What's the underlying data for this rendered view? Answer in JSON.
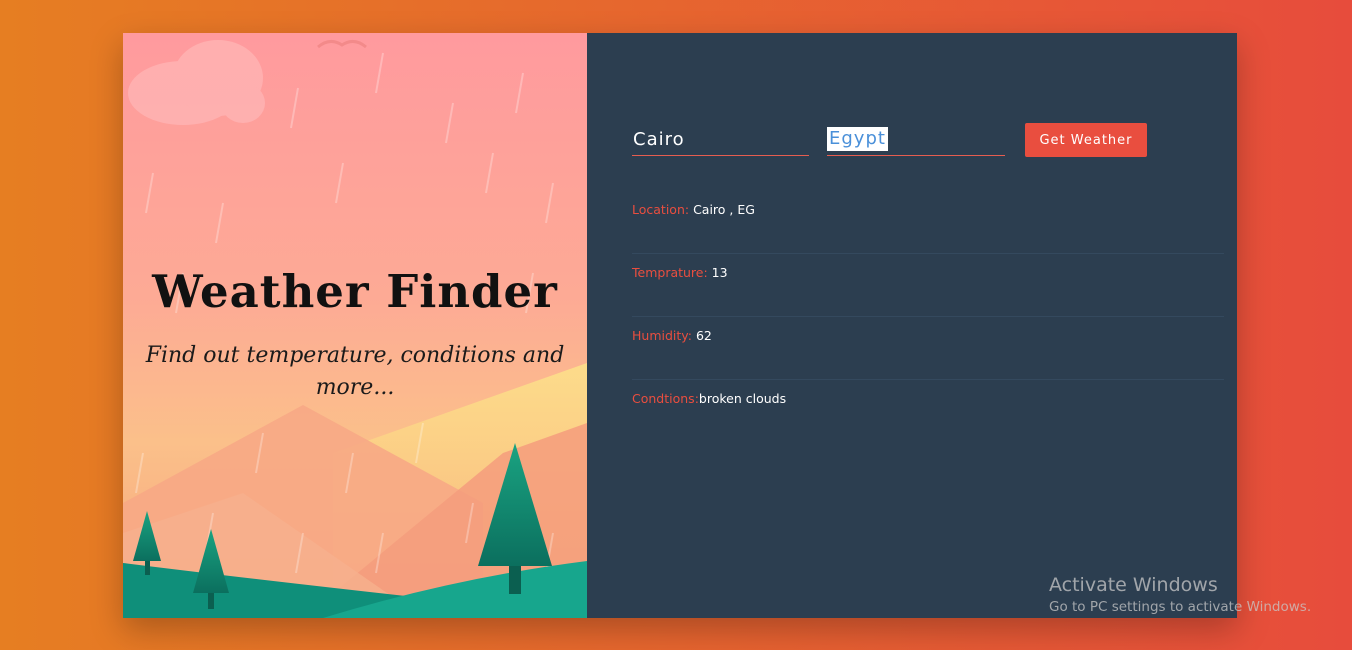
{
  "hero": {
    "title": "Weather Finder",
    "subtitle": "Find out temperature, conditions and more..."
  },
  "form": {
    "city_value": "Cairo",
    "country_value": "Egypt",
    "submit_label": "Get Weather"
  },
  "results": [
    {
      "label": "Location:",
      "value": " Cairo , EG"
    },
    {
      "label": "Temprature:",
      "value": " 13"
    },
    {
      "label": "Humidity:",
      "value": " 62"
    },
    {
      "label": "Condtions:",
      "value": "broken clouds"
    }
  ],
  "watermark": {
    "title": "Activate Windows",
    "subtitle": "Go to PC settings to activate Windows."
  },
  "colors": {
    "accent": "#e94e3f",
    "panel": "#2c3e50",
    "background_start": "#e67e22",
    "background_end": "#e74c3c"
  }
}
